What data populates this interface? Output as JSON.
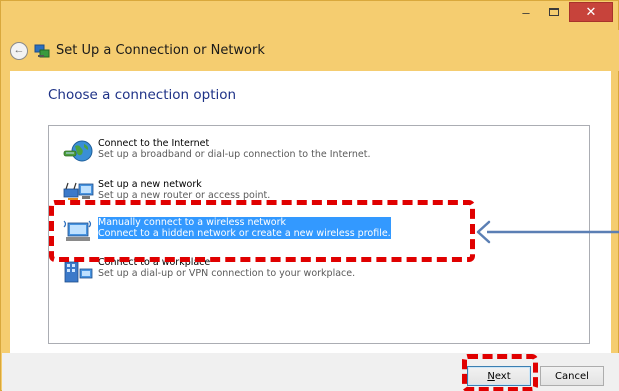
{
  "window": {
    "minimize_glyph": "–",
    "close_glyph": "✕",
    "title": "Set Up a Connection or Network"
  },
  "content": {
    "instruction": "Choose a connection option",
    "options": [
      {
        "title": "Connect to the Internet",
        "desc": "Set up a broadband or dial-up connection to the Internet.",
        "icon": "globe-icon",
        "selected": false
      },
      {
        "title": "Set up a new network",
        "desc": "Set up a new router or access point.",
        "icon": "router-icon",
        "selected": false
      },
      {
        "title": "Manually connect to a wireless network",
        "desc": "Connect to a hidden network or create a new wireless profile.",
        "icon": "wireless-computer-icon",
        "selected": true
      },
      {
        "title": "Connect to a workplace",
        "desc": "Set up a dial-up or VPN connection to your workplace.",
        "icon": "workplace-icon",
        "selected": false
      }
    ]
  },
  "footer": {
    "next_label": "Next",
    "cancel_label": "Cancel"
  },
  "colors": {
    "frame": "#f5cd70",
    "selection": "#3399ff",
    "instruction_text": "#1e3287",
    "annotation_red": "#e00000",
    "arrow_blue": "#5b7fb4"
  }
}
